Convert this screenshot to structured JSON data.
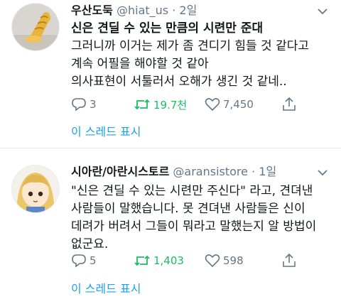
{
  "tweets": [
    {
      "name": "우산도둑",
      "handle": "@hiat_us",
      "separator": "·",
      "time": "2일",
      "lines": [
        "신은 견딜 수 있는 만큼의 시련만 준대",
        "그러니까 이거는 제가 좀 견디기 힘들 것 같다고",
        "계속 어필을 해야할 것 같아",
        "의사표현이 서툴러서 오해가 생긴 것 같네.."
      ],
      "replies": "3",
      "retweets": "19.7천",
      "likes": "7,450",
      "thread_link": "이 스레드 표시"
    },
    {
      "name": "시아란/아란시스토르",
      "handle": "@aransistore",
      "separator": "·",
      "time": "1일",
      "lines": [
        "\"신은 견딜 수 있는 시련만 주신다\" 라고, 견뎌낸",
        "사람들이 말했습니다. 못 견뎌낸 사람들은 신이",
        "데려가 버려서 그들이 뭐라고 말했는지 알 방법이",
        "없군요."
      ],
      "replies": "5",
      "retweets": "1,403",
      "likes": "598",
      "thread_link": "이 스레드 표시"
    }
  ],
  "colors": {
    "link": "#1da1f2",
    "retweet_active": "#17bf63",
    "muted": "#657786",
    "divider": "#e1e8ed"
  },
  "icons": {
    "menu": "chevron-down-icon",
    "reply": "reply-icon",
    "retweet": "retweet-icon",
    "like": "heart-icon",
    "share": "share-icon"
  }
}
